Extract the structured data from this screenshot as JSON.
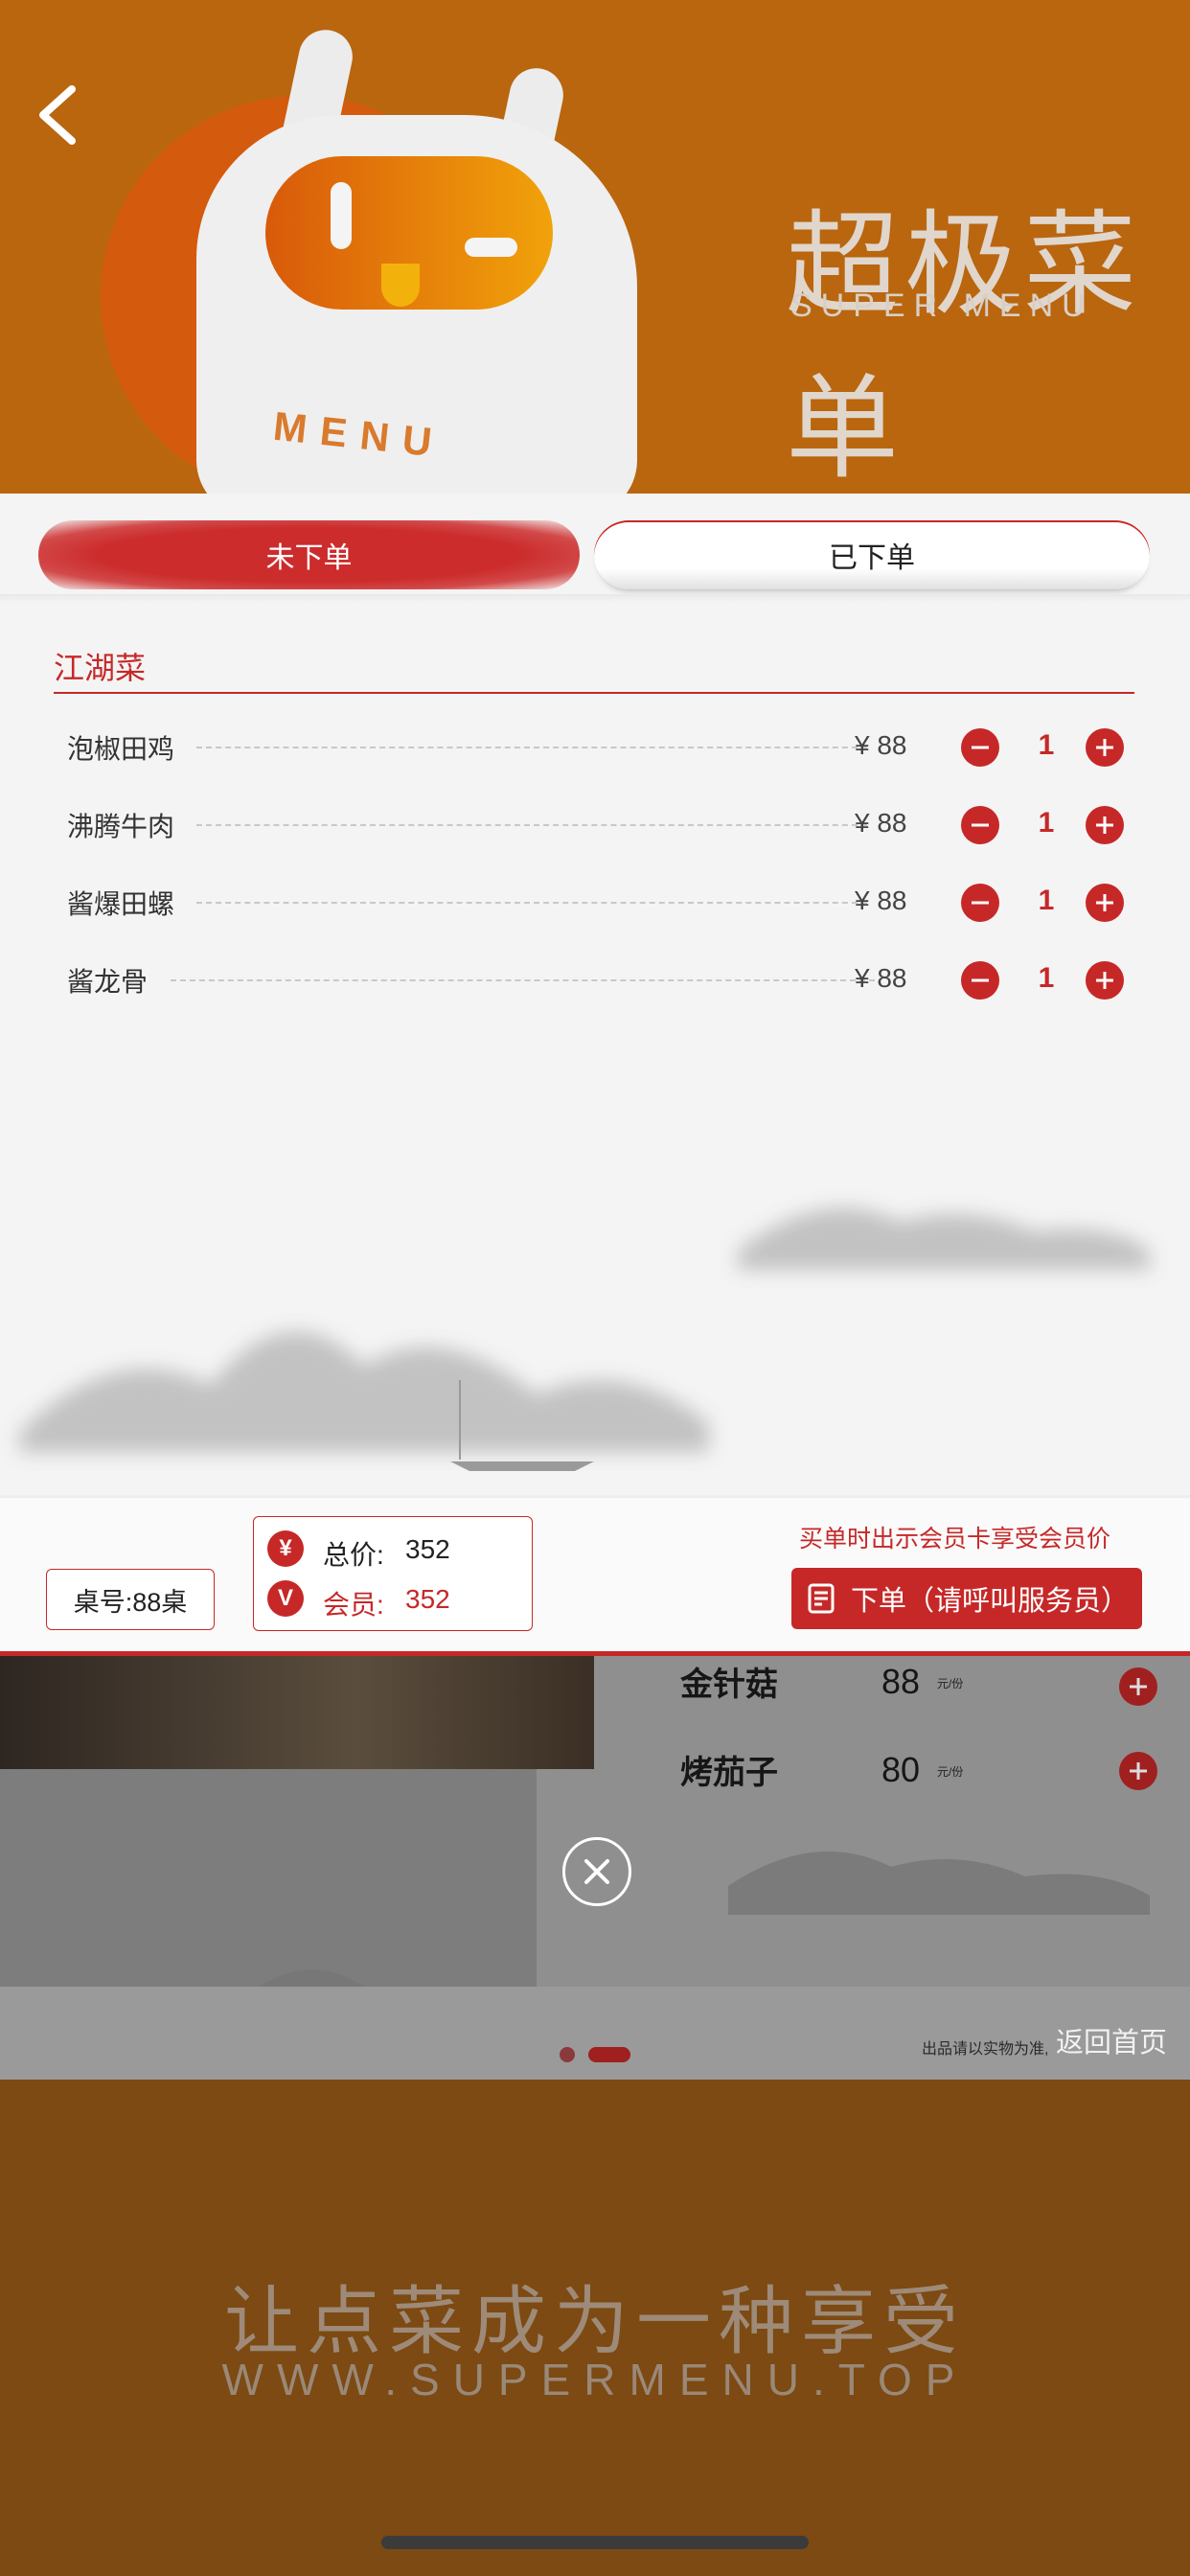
{
  "header": {
    "mascot_text": "MENU",
    "brand_cn": "超极菜单",
    "brand_en": "SUPER MENU"
  },
  "tabs": [
    {
      "label": "未下单",
      "active": true
    },
    {
      "label": "已下单",
      "active": false
    }
  ],
  "category": {
    "title": "江湖菜",
    "items": [
      {
        "name": "泡椒田鸡",
        "price": "¥ 88",
        "qty": "1"
      },
      {
        "name": "沸腾牛肉",
        "price": "¥ 88",
        "qty": "1"
      },
      {
        "name": "酱爆田螺",
        "price": "¥ 88",
        "qty": "1"
      },
      {
        "name": "酱龙骨",
        "price": "¥ 88",
        "qty": "1"
      }
    ]
  },
  "bottom_bar": {
    "table": "桌号:88桌",
    "total_icon": "¥",
    "total_label": "总价:",
    "total_value": "352",
    "member_icon": "V",
    "member_label": "会员:",
    "member_value": "352",
    "promo": "买单时出示会员卡享受会员价",
    "order_button": "下单（请呼叫服务员）"
  },
  "background_menu": {
    "items": [
      {
        "name": "金针菇",
        "price": "88",
        "unit": "元/份"
      },
      {
        "name": "烤茄子",
        "price": "80",
        "unit": "元/份"
      }
    ],
    "note": "出品请以实物为准,",
    "home_link": "返回首页"
  },
  "footer": {
    "slogan": "让点菜成为一种享受",
    "website": "WWW.SUPERMENU.TOP"
  },
  "colors": {
    "accent": "#c62828",
    "header_bg": "#b9660f",
    "footer_bg": "#7c4a12"
  }
}
